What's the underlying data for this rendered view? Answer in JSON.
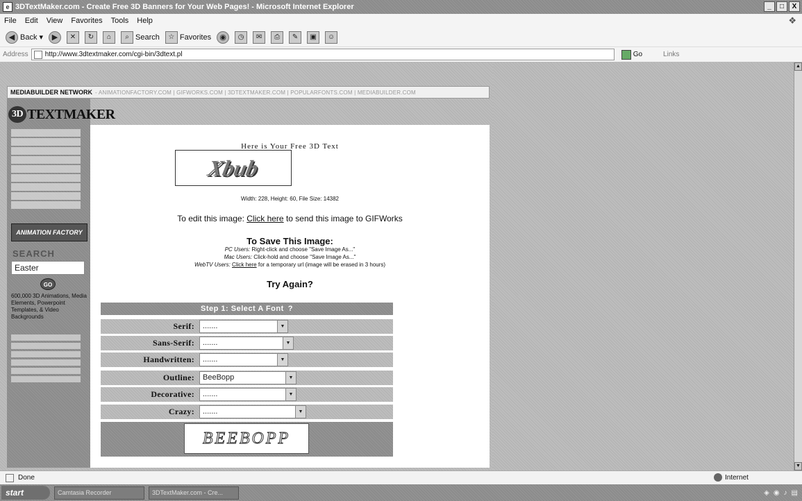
{
  "window": {
    "title": "3DTextMaker.com - Create Free 3D Banners for Your Web Pages! - Microsoft Internet Explorer",
    "controls": [
      "_",
      "□",
      "X"
    ]
  },
  "menu": [
    "File",
    "Edit",
    "View",
    "Favorites",
    "Tools",
    "Help"
  ],
  "toolbar": {
    "back_label": "Back",
    "search_label": "Search",
    "favorites_label": "Favorites"
  },
  "address": {
    "label": "Address",
    "url": "http://www.3dtextmaker.com/cgi-bin/3dtext.pl",
    "go_label": "Go",
    "links_label": "Links"
  },
  "network": {
    "name": "MEDIABUILDER NETWORK",
    "links": "- ANIMATIONFACTORY.COM | GIFWORKS.COM | 3DTEXTMAKER.COM | POPULARFONTS.COM | MEDIABUILDER.COM"
  },
  "site": {
    "logo_badge": "3D",
    "logo_text": "TEXTMAKER",
    "animation_logo": "ANIMATION FACTORY",
    "search_title": "SEARCH",
    "search_value": "Easter",
    "go_button": "GO",
    "promo_text": "600,000 3D Animations, Media Elements, Powerpoint Templates, & Video Backgrounds"
  },
  "result": {
    "title": "Here is Your Free 3D Text",
    "banner_text": "Xbub",
    "info": "Width: 228, Height: 60, File Size: 14382",
    "edit_prefix": "To edit this image:",
    "edit_link": "Click here",
    "edit_suffix": "to send this image to GIFWorks",
    "save_title": "To Save This Image:",
    "pc_label": "PC Users:",
    "pc_text": "Right-click and choose \"Save Image As...\"",
    "mac_label": "Mac Users:",
    "mac_text": "Click-hold and choose \"Save Image As...\"",
    "webtv_label": "WebTV Users:",
    "webtv_link": "Click here",
    "webtv_text": "for a temporary url (image will be erased in 3 hours)",
    "try_again": "Try Again?"
  },
  "step": {
    "heading": "Step 1: Select A Font",
    "help_icon": "?",
    "rows": [
      {
        "label": "Serif:",
        "value": "......."
      },
      {
        "label": "Sans-Serif:",
        "value": "......."
      },
      {
        "label": "Handwritten:",
        "value": "......."
      },
      {
        "label": "Outline:",
        "value": "BeeBopp"
      },
      {
        "label": "Decorative:",
        "value": "......."
      },
      {
        "label": "Crazy:",
        "value": "......."
      }
    ],
    "preview_text": "BEEBOPP"
  },
  "status": {
    "text": "Done",
    "zone": "Internet"
  },
  "taskbar": {
    "start": "start",
    "items": [
      "Camtasia Recorder",
      "3DTextMaker.com - Cre..."
    ]
  }
}
